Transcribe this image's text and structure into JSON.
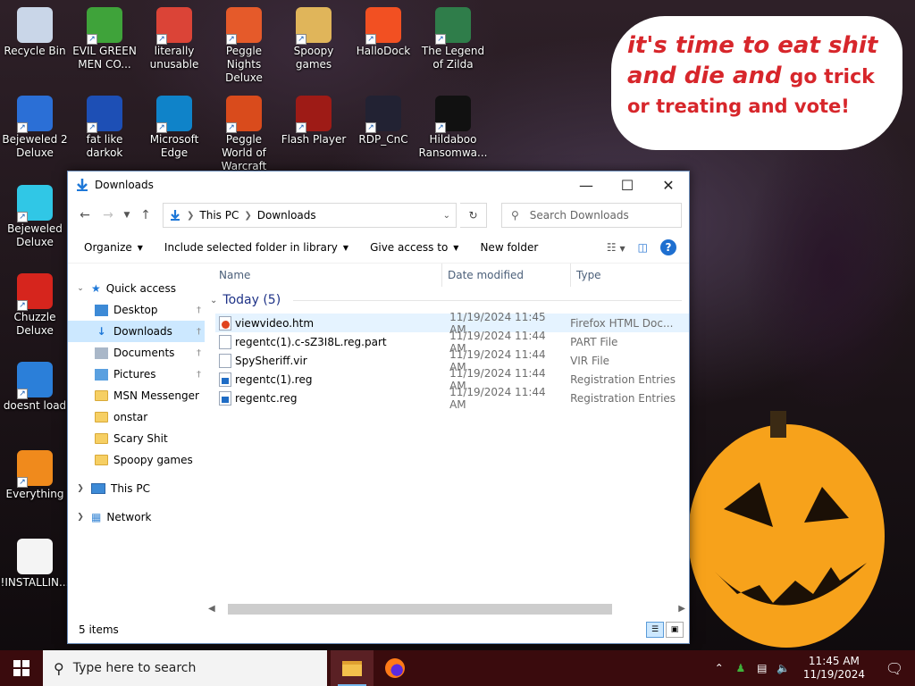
{
  "desktop": {
    "icons": [
      {
        "name": "recycle-bin-icon",
        "label": "Recycle Bin",
        "color": "#c9d6e8"
      },
      {
        "name": "evil-green-men-icon",
        "label": "EVIL GREEN MEN CO...",
        "color": "#3fa33a"
      },
      {
        "name": "chrome-icon",
        "label": "literally unusable",
        "color": "#db4437"
      },
      {
        "name": "peggle-nights-icon",
        "label": "Peggle Nights Deluxe",
        "color": "#e55a2a"
      },
      {
        "name": "spoopy-games-folder-icon",
        "label": "Spoopy games",
        "color": "#e0b55a"
      },
      {
        "name": "hallodock-icon",
        "label": "HalloDock",
        "color": "#f25022"
      },
      {
        "name": "legend-of-zilda-icon",
        "label": "The Legend of Zilda",
        "color": "#2f7d4a"
      },
      {
        "name": "bejeweled-2-icon",
        "label": "Bejeweled 2 Deluxe",
        "color": "#2b6fd6"
      },
      {
        "name": "fat-like-darkok-icon",
        "label": "fat like darkok",
        "color": "#1d4fb5"
      },
      {
        "name": "microsoft-edge-icon",
        "label": "Microsoft Edge",
        "color": "#0f83c9"
      },
      {
        "name": "peggle-world-of-warcraft-icon",
        "label": "Peggle World of Warcraft",
        "color": "#d94b1c"
      },
      {
        "name": "flash-player-icon",
        "label": "Flash Player",
        "color": "#9e1b16"
      },
      {
        "name": "rdp-cnc-icon",
        "label": "RDP_CnC",
        "color": "#223"
      },
      {
        "name": "hildaboo-ransomware-icon",
        "label": "Hildaboo Ransomwa...",
        "color": "#111"
      },
      {
        "name": "bejeweled-deluxe-icon",
        "label": "Bejeweled Deluxe",
        "color": "#30c7e6"
      },
      {
        "name": "chuzzle-deluxe-icon",
        "label": "Chuzzle Deluxe",
        "color": "#d6251d"
      },
      {
        "name": "thunderbird-icon",
        "label": "doesnt load",
        "color": "#2b7fd9"
      },
      {
        "name": "everything-icon",
        "label": "Everything",
        "color": "#f08a1c"
      },
      {
        "name": "text-document-icon",
        "label": "!INSTALLIN...",
        "color": "#f4f4f4"
      }
    ],
    "bubble": {
      "line1": "it's time to eat shit",
      "line2a": "and die and",
      "line2b": "go trick",
      "line3": "or treating and vote!"
    }
  },
  "explorer": {
    "title": "Downloads",
    "address": {
      "root": "This PC",
      "current": "Downloads"
    },
    "search_placeholder": "Search Downloads",
    "commands": [
      "Organize",
      "Include selected folder in library",
      "Give access to",
      "New folder"
    ],
    "nav": {
      "quick_access": "Quick access",
      "pinned": [
        {
          "label": "Desktop",
          "icon": "desktop-icon"
        },
        {
          "label": "Downloads",
          "icon": "downloads-icon"
        },
        {
          "label": "Documents",
          "icon": "documents-icon"
        },
        {
          "label": "Pictures",
          "icon": "pictures-icon"
        }
      ],
      "folders": [
        "MSN Messenger",
        "onstar",
        "Scary Shit",
        "Spoopy games"
      ],
      "this_pc": "This PC",
      "network": "Network"
    },
    "columns": [
      "Name",
      "Date modified",
      "Type"
    ],
    "group_label": "Today (5)",
    "files": [
      {
        "name": "viewvideo.htm",
        "date": "11/19/2024 11:45 AM",
        "type": "Firefox HTML Doc...",
        "icon": "htm"
      },
      {
        "name": "regentc(1).c-sZ3I8L.reg.part",
        "date": "11/19/2024 11:44 AM",
        "type": "PART File",
        "icon": "file"
      },
      {
        "name": "SpySheriff.vir",
        "date": "11/19/2024 11:44 AM",
        "type": "VIR File",
        "icon": "file"
      },
      {
        "name": "regentc(1).reg",
        "date": "11/19/2024 11:44 AM",
        "type": "Registration Entries",
        "icon": "reg"
      },
      {
        "name": "regentc.reg",
        "date": "11/19/2024 11:44 AM",
        "type": "Registration Entries",
        "icon": "reg"
      }
    ],
    "status": "5 items"
  },
  "taskbar": {
    "search_placeholder": "Type here to search",
    "time": "11:45 AM",
    "date": "11/19/2024"
  }
}
